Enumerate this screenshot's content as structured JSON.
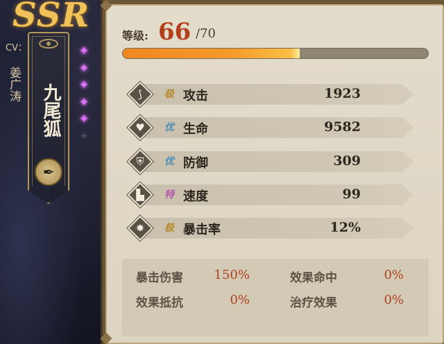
{
  "portrait": {
    "rarity": "SSR",
    "cv_label": "CV：",
    "cv_name": "姜广涛",
    "character_name": "九尾狐",
    "awakening_butterflies": [
      true,
      true,
      true,
      true,
      true,
      false
    ],
    "quill_icon": "quill-icon"
  },
  "level": {
    "label": "等级:",
    "current": "66",
    "max": "/70",
    "progress_fraction": 0.58
  },
  "stats": [
    {
      "icon": "sword-slash-icon",
      "grade": "极",
      "grade_color": "#b58a2a",
      "name": "攻击",
      "value": "1923"
    },
    {
      "icon": "heart-icon",
      "grade": "优",
      "grade_color": "#4f8fb7",
      "name": "生命",
      "value": "9582"
    },
    {
      "icon": "shield-icon",
      "grade": "优",
      "grade_color": "#4f8fb7",
      "name": "防御",
      "value": "309"
    },
    {
      "icon": "boot-icon",
      "grade": "特",
      "grade_color": "#b05aa8",
      "name": "速度",
      "value": "99"
    },
    {
      "icon": "crit-burst-icon",
      "grade": "极",
      "grade_color": "#b58a2a",
      "name": "暴击率",
      "value": "12%"
    }
  ],
  "secondary": {
    "crit_damage_label": "暴击伤害",
    "crit_damage_value": "150%",
    "effect_hit_label": "效果命中",
    "effect_hit_value": "0%",
    "effect_resist_label": "效果抵抗",
    "effect_resist_value": "0%",
    "healing_label": "治疗效果",
    "healing_value": "0%"
  }
}
